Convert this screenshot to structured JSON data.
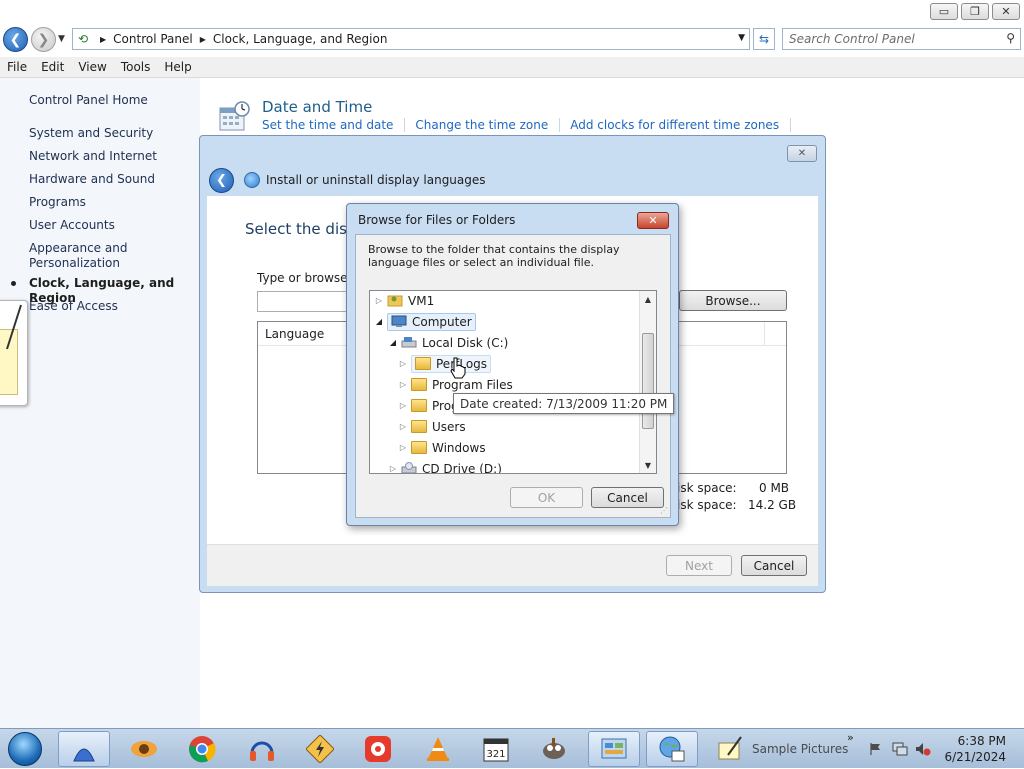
{
  "window": {
    "minimize": "▭",
    "restore": "❐",
    "close": "✕"
  },
  "address": {
    "crumbs": [
      "Control Panel",
      "Clock, Language, and Region"
    ],
    "search_placeholder": "Search Control Panel"
  },
  "menu": [
    "File",
    "Edit",
    "View",
    "Tools",
    "Help"
  ],
  "sidebar": {
    "home": "Control Panel Home",
    "items": [
      {
        "label": "System and Security"
      },
      {
        "label": "Network and Internet"
      },
      {
        "label": "Hardware and Sound"
      },
      {
        "label": "Programs"
      },
      {
        "label": "User Accounts"
      },
      {
        "label": "Appearance and Personalization"
      },
      {
        "label": "Clock, Language, and Region",
        "current": true
      },
      {
        "label": "Ease of Access"
      }
    ]
  },
  "category": {
    "title": "Date and Time",
    "links": [
      "Set the time and date",
      "Change the time zone",
      "Add clocks for different time zones"
    ]
  },
  "wizard": {
    "title": "Install or uninstall display languages",
    "heading_partial": "Select the disp",
    "type_label_partial": "Type or browse t",
    "browse_button": "Browse...",
    "column_language": "Language",
    "disk_space_required_label": "isk space:",
    "disk_space_required_value": "0 MB",
    "disk_space_available_label": "isk space:",
    "disk_space_available_value": "14.2 GB",
    "next_button": "Next",
    "cancel_button": "Cancel"
  },
  "browse_dialog": {
    "title": "Browse for Files or Folders",
    "description": "Browse to the folder that contains the display language files or select an individual file.",
    "tree": [
      {
        "label": "VM1",
        "depth": 0,
        "expander": "closed",
        "icon": "user-folder-icon"
      },
      {
        "label": "Computer",
        "depth": 0,
        "expander": "open",
        "icon": "computer-icon",
        "selected": true
      },
      {
        "label": "Local Disk (C:)",
        "depth": 1,
        "expander": "open",
        "icon": "drive-icon"
      },
      {
        "label": "PerfLogs",
        "depth": 2,
        "expander": "closed",
        "icon": "folder-icon",
        "hover": true
      },
      {
        "label": "Program Files",
        "depth": 2,
        "expander": "closed",
        "icon": "folder-icon"
      },
      {
        "label": "Prog",
        "depth": 2,
        "expander": "closed",
        "icon": "folder-icon"
      },
      {
        "label": "Users",
        "depth": 2,
        "expander": "closed",
        "icon": "folder-icon"
      },
      {
        "label": "Windows",
        "depth": 2,
        "expander": "closed",
        "icon": "folder-icon"
      },
      {
        "label": "CD Drive (D:)",
        "depth": 1,
        "expander": "closed",
        "icon": "cd-drive-icon"
      }
    ],
    "tooltip": "Date created: 7/13/2009 11:20 PM",
    "ok_button": "OK",
    "cancel_button": "Cancel"
  },
  "taskbar": {
    "apps": [
      {
        "name": "shark-fin-icon",
        "active": true
      },
      {
        "name": "eye-app-icon"
      },
      {
        "name": "chrome-icon"
      },
      {
        "name": "headphones-icon"
      },
      {
        "name": "flash-app-icon"
      },
      {
        "name": "record-app-icon"
      },
      {
        "name": "vlc-icon"
      },
      {
        "name": "calendar-321-icon"
      },
      {
        "name": "gimp-icon"
      },
      {
        "name": "control-panel-icon",
        "active": true
      },
      {
        "name": "region-globe-icon",
        "active": true
      },
      {
        "name": "notepad-pen-icon"
      }
    ],
    "tray_label": "Sample Pictures",
    "tray_chevron": "»",
    "time": "6:38 PM",
    "date": "6/21/2024"
  },
  "colors": {
    "link": "#1f68c0",
    "category_title": "#1e5e8c",
    "dialog_frame": "#c8dcf2",
    "taskbar": "#b3c9e2"
  }
}
